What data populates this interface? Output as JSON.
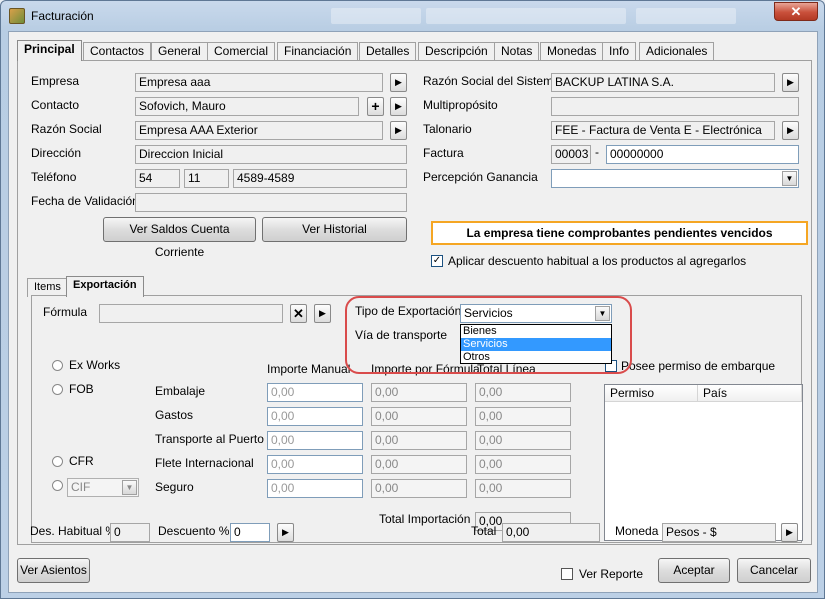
{
  "window": {
    "title": "Facturación",
    "close_glyph": "✕",
    "icon": "app-icon",
    "highlight_color": "#d94b4b",
    "warn_border_color": "#f5a623"
  },
  "tabs": [
    "Principal",
    "Contactos",
    "General",
    "Comercial",
    "Financiación",
    "Detalles",
    "Descripción",
    "Notas",
    "Monedas",
    "Info",
    "Adicionales"
  ],
  "left": {
    "empresa_label": "Empresa",
    "empresa_value": "Empresa aaa",
    "contacto_label": "Contacto",
    "contacto_value": "Sofovich, Mauro",
    "razon_label": "Razón Social",
    "razon_value": "Empresa AAA Exterior",
    "direccion_label": "Dirección",
    "direccion_value": "Direccion Inicial",
    "telefono_label": "Teléfono",
    "tel_1": "54",
    "tel_2": "11",
    "tel_3": "4589-4589",
    "fecha_label": "Fecha de Validación",
    "ver_saldos": "Ver Saldos Cuenta Corriente",
    "ver_historial": "Ver Historial"
  },
  "right": {
    "razon_sistema_label": "Razón Social del Sistema",
    "razon_sistema_value": "BACKUP LATINA S.A.",
    "multiproposito_label": "Multipropósito",
    "talonario_label": "Talonario",
    "talonario_value": "FEE - Factura de Venta E - Electrónica",
    "factura_label": "Factura",
    "factura_pv": "00003",
    "factura_sep": "-",
    "factura_num": "00000000",
    "percepcion_label": "Percepción Ganancia",
    "warning": "La empresa tiene comprobantes pendientes vencidos",
    "descuento_check_label": "Aplicar descuento habitual a los productos al agregarlos"
  },
  "subtabs": [
    "Items",
    "Exportación"
  ],
  "export": {
    "formula_label": "Fórmula",
    "tipo_label": "Tipo de Exportación",
    "tipo_value": "Servicios",
    "tipo_options": [
      "Bienes",
      "Servicios",
      "Otros"
    ],
    "via_label": "Vía de transporte",
    "col_manual": "Importe Manual",
    "col_formula": "Importe por Fórmula",
    "col_total": "Total Línea",
    "radio_exworks": "Ex Works",
    "radio_fob": "FOB",
    "radio_cfr": "CFR",
    "cif_value": "CIF",
    "rows": [
      {
        "label": "Embalaje",
        "manual": "0,00",
        "formula": "0,00",
        "total": "0,00"
      },
      {
        "label": "Gastos",
        "manual": "0,00",
        "formula": "0,00",
        "total": "0,00"
      },
      {
        "label": "Transporte al Puerto",
        "manual": "0,00",
        "formula": "0,00",
        "total": "0,00"
      },
      {
        "label": "Flete Internacional",
        "manual": "0,00",
        "formula": "0,00",
        "total": "0,00"
      },
      {
        "label": "Seguro",
        "manual": "0,00",
        "formula": "0,00",
        "total": "0,00"
      }
    ],
    "total_import_label": "Total Importación",
    "total_import_value": "0,00",
    "permiso_label": "Posee permiso de embarque",
    "list_col_permiso": "Permiso",
    "list_col_pais": "País"
  },
  "footer": {
    "des_label": "Des. Habitual %",
    "des_value": "0",
    "descuento_label": "Descuento %",
    "descuento_value": "0",
    "total_label": "Total",
    "total_value": "0,00",
    "moneda_label": "Moneda",
    "moneda_value": "Pesos - $",
    "ver_asientos": "Ver Asientos",
    "ver_reporte": "Ver Reporte",
    "aceptar": "Aceptar",
    "cancelar": "Cancelar"
  }
}
